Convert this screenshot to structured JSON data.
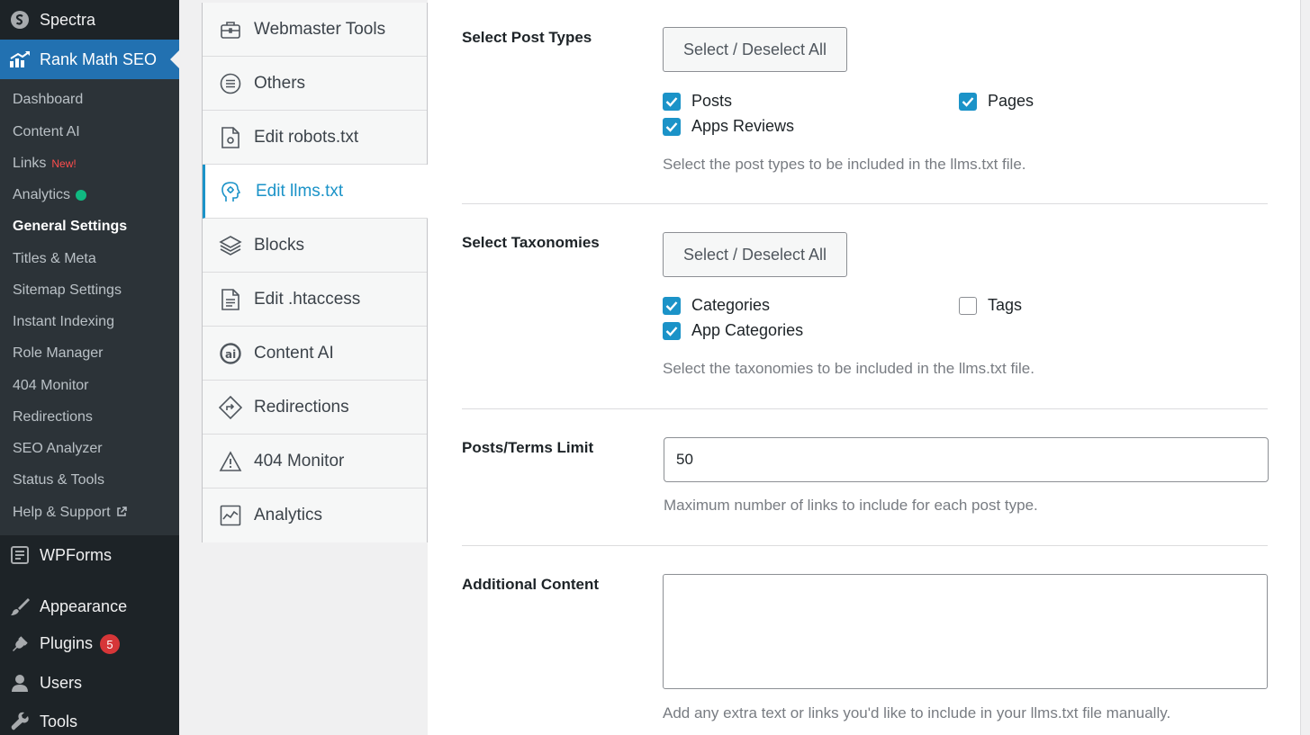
{
  "admin_menu": {
    "spectra": "Spectra",
    "rankmath": "Rank Math SEO",
    "submenu": [
      {
        "label": "Dashboard"
      },
      {
        "label": "Content AI"
      },
      {
        "label": "Links",
        "badge": "New!"
      },
      {
        "label": "Analytics"
      },
      {
        "label": "General Settings"
      },
      {
        "label": "Titles & Meta"
      },
      {
        "label": "Sitemap Settings"
      },
      {
        "label": "Instant Indexing"
      },
      {
        "label": "Role Manager"
      },
      {
        "label": "404 Monitor"
      },
      {
        "label": "Redirections"
      },
      {
        "label": "SEO Analyzer"
      },
      {
        "label": "Status & Tools"
      },
      {
        "label": "Help & Support"
      }
    ],
    "wpforms": "WPForms",
    "appearance": "Appearance",
    "plugins": "Plugins",
    "plugins_count": "5",
    "users": "Users",
    "tools": "Tools"
  },
  "tabs": [
    {
      "label": "Webmaster Tools",
      "icon": "briefcase-icon"
    },
    {
      "label": "Others",
      "icon": "list-circle-icon"
    },
    {
      "label": "Edit robots.txt",
      "icon": "robots-file-icon"
    },
    {
      "label": "Edit llms.txt",
      "icon": "ai-head-icon",
      "active": true
    },
    {
      "label": "Blocks",
      "icon": "blocks-icon"
    },
    {
      "label": "Edit .htaccess",
      "icon": "document-icon"
    },
    {
      "label": "Content AI",
      "icon": "content-ai-icon"
    },
    {
      "label": "Redirections",
      "icon": "redirect-diamond-icon"
    },
    {
      "label": "404 Monitor",
      "icon": "warning-icon"
    },
    {
      "label": "Analytics",
      "icon": "analytics-chart-icon"
    }
  ],
  "settings": {
    "post_types": {
      "label": "Select Post Types",
      "button": "Select / Deselect All",
      "options": [
        {
          "label": "Posts",
          "checked": true
        },
        {
          "label": "Pages",
          "checked": true
        },
        {
          "label": "Apps Reviews",
          "checked": true
        }
      ],
      "description": "Select the post types to be included in the llms.txt file."
    },
    "taxonomies": {
      "label": "Select Taxonomies",
      "button": "Select / Deselect All",
      "options": [
        {
          "label": "Categories",
          "checked": true
        },
        {
          "label": "Tags",
          "checked": false
        },
        {
          "label": "App Categories",
          "checked": true
        }
      ],
      "description": "Select the taxonomies to be included in the llms.txt file."
    },
    "limit": {
      "label": "Posts/Terms Limit",
      "value": "50",
      "description": "Maximum number of links to include for each post type."
    },
    "additional": {
      "label": "Additional Content",
      "value": "",
      "description": "Add any extra text or links you'd like to include in your llms.txt file manually."
    }
  },
  "colors": {
    "admin_bg": "#1d2327",
    "submenu_bg": "#2c3338",
    "wp_blue": "#2271b1",
    "accent": "#1b93c8",
    "badge_red": "#d63638"
  }
}
